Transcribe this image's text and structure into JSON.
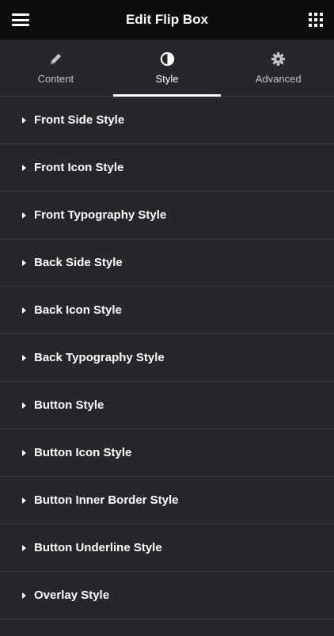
{
  "header": {
    "title": "Edit Flip Box",
    "menu_icon": "hamburger-icon",
    "apps_icon": "grid-icon"
  },
  "tabs": [
    {
      "label": "Content",
      "icon": "pencil-icon",
      "active": false
    },
    {
      "label": "Style",
      "icon": "contrast-icon",
      "active": true
    },
    {
      "label": "Advanced",
      "icon": "gear-icon",
      "active": false
    }
  ],
  "sections": [
    {
      "label": "Front Side Style"
    },
    {
      "label": "Front Icon Style"
    },
    {
      "label": "Front Typography Style"
    },
    {
      "label": "Back Side Style"
    },
    {
      "label": "Back Icon Style"
    },
    {
      "label": "Back Typography Style"
    },
    {
      "label": "Button Style"
    },
    {
      "label": "Button Icon Style"
    },
    {
      "label": "Button Inner Border Style"
    },
    {
      "label": "Button Underline Style"
    },
    {
      "label": "Overlay Style"
    }
  ],
  "colors": {
    "header_bg": "#0c0d0e",
    "panel_bg": "#26272b",
    "divider": "#3a3b40",
    "text": "#ffffff"
  }
}
